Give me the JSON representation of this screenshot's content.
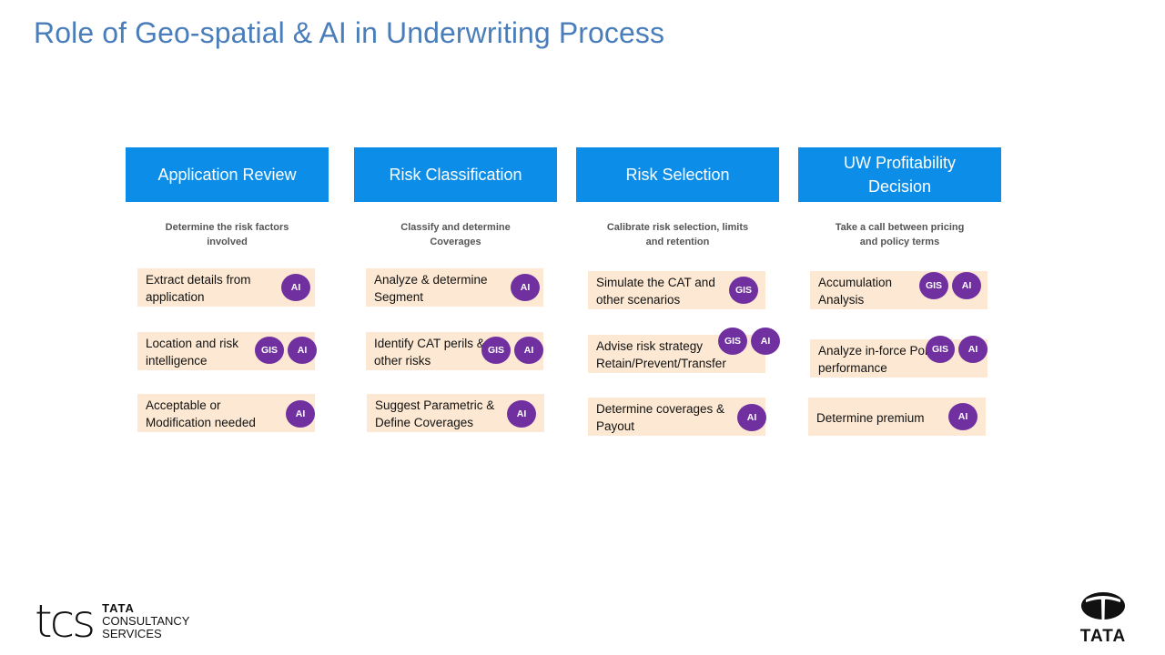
{
  "title": "Role of Geo-spatial & AI in Underwriting Process",
  "columns": [
    {
      "heading": "Application Review",
      "subtitle": "Determine the risk factors involved",
      "tasks": [
        {
          "text": "Extract details from application",
          "tags": [
            "AI"
          ]
        },
        {
          "text": "Location and risk intelligence",
          "tags": [
            "GIS",
            "AI"
          ]
        },
        {
          "text": "Acceptable or Modification needed",
          "tags": [
            "AI"
          ]
        }
      ]
    },
    {
      "heading": "Risk Classification",
      "subtitle": "Classify and determine Coverages",
      "tasks": [
        {
          "text": "Analyze & determine Segment",
          "tags": [
            "AI"
          ]
        },
        {
          "text": "Identify CAT perils & other risks",
          "tags": [
            "GIS",
            "AI"
          ]
        },
        {
          "text": "Suggest Parametric & Define Coverages",
          "tags": [
            "AI"
          ]
        }
      ]
    },
    {
      "heading": "Risk Selection",
      "subtitle": "Calibrate risk selection, limits and retention",
      "tasks": [
        {
          "text": "Simulate the CAT and other scenarios",
          "tags": [
            "GIS"
          ]
        },
        {
          "text": "Advise risk strategy Retain/Prevent/Transfer",
          "tags": [
            "GIS",
            "AI"
          ]
        },
        {
          "text": "Determine coverages & Payout",
          "tags": [
            "AI"
          ]
        }
      ]
    },
    {
      "heading": "UW Profitability Decision",
      "subtitle": "Take a call between pricing and policy terms",
      "tasks": [
        {
          "text": "Accumulation Analysis",
          "tags": [
            "GIS",
            "AI"
          ]
        },
        {
          "text": "Analyze in-force Portfolio performance",
          "tags": [
            "GIS",
            "AI"
          ]
        },
        {
          "text": "Determine premium",
          "tags": [
            "AI"
          ]
        }
      ]
    }
  ],
  "footer": {
    "tcs_mark": "tcs",
    "tcs_line1": "TATA",
    "tcs_line2": "CONSULTANCY",
    "tcs_line3": "SERVICES",
    "tata_word": "TATA"
  },
  "colors": {
    "header_blue": "#0c8ee8",
    "task_bg": "#fde9d3",
    "badge_purple": "#7030a0",
    "title_blue": "#4a7ebb"
  }
}
